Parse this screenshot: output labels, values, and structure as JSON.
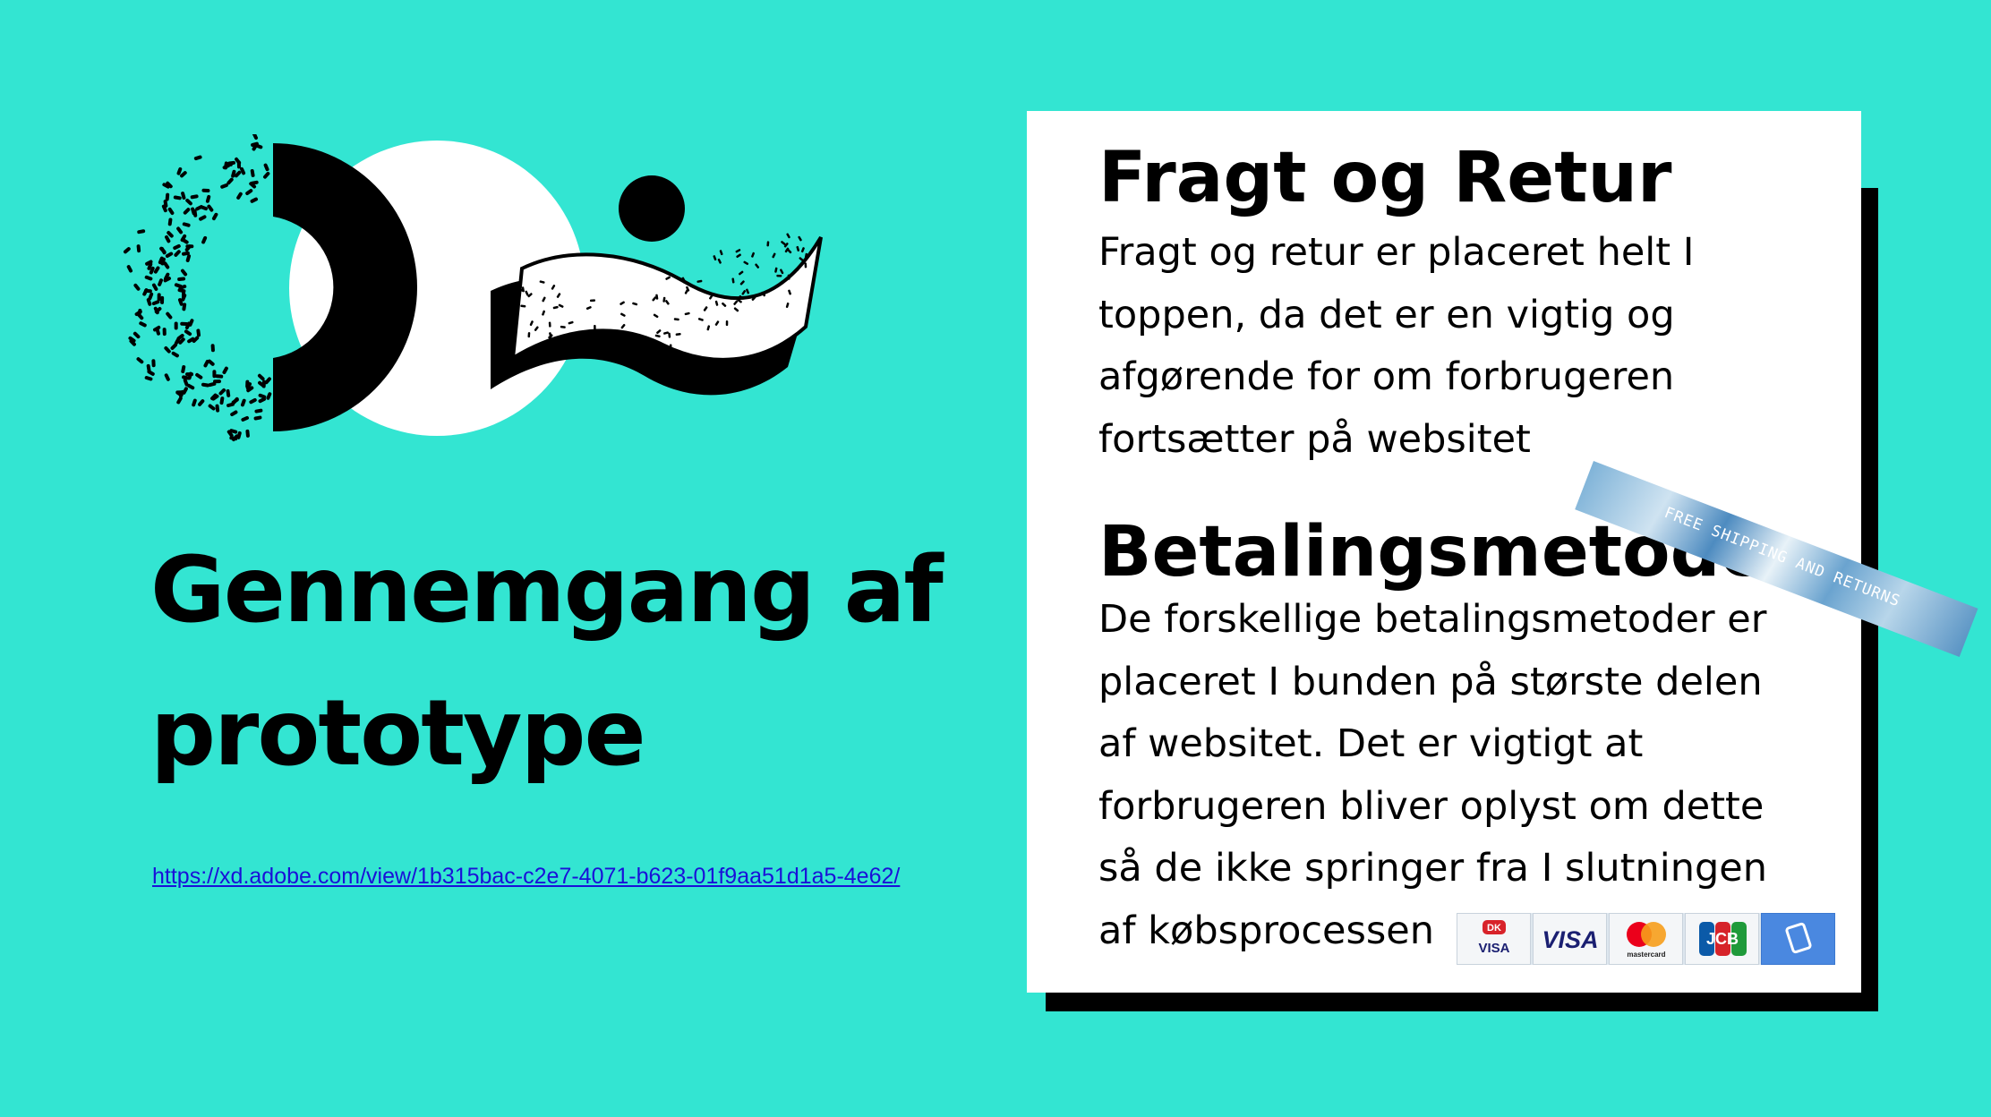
{
  "slide": {
    "title_line1": "Gennemgang af",
    "title_line2": "prototype",
    "link": "https://xd.adobe.com/view/1b315bac-c2e7-4071-b623-01f9aa51d1a5-4e62/"
  },
  "card": {
    "heading1": "Fragt og Retur",
    "body1": [
      "Fragt og retur er placeret helt I",
      "toppen, da det er en vigtig og",
      "afgørende for om forbrugeren",
      "fortsætter på websitet"
    ],
    "heading2": "Betalingsmetode",
    "body2": [
      "De forskellige betalingsmetoder er",
      "placeret I bunden på største delen",
      "af websitet. Det er vigtigt at",
      "forbrugeren bliver oplyst om dette",
      "så de ikke springer fra I slutningen",
      "af købsprocessen"
    ]
  },
  "banner": {
    "text": "FREE SHIPPING AND RETURNS"
  },
  "payment_cards": {
    "dankort": "VISA",
    "visa": "VISA",
    "mastercard": "mastercard",
    "jcb": "JCB",
    "mobilepay": "mobilepay-icon"
  },
  "colors": {
    "background": "#33e5d2",
    "card": "#ffffff",
    "shadow": "#000000",
    "link": "#1a10d8"
  }
}
